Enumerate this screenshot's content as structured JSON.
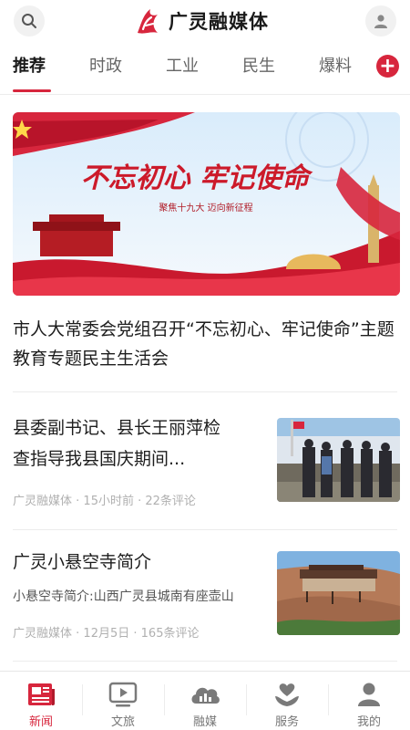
{
  "header": {
    "app_title": "广灵融媒体",
    "logo_icon": "logo-icon",
    "search_icon": "search-icon",
    "user_icon": "user-icon"
  },
  "tabs": [
    {
      "label": "推荐",
      "active": true
    },
    {
      "label": "时政"
    },
    {
      "label": "工业"
    },
    {
      "label": "民生"
    },
    {
      "label": "爆料"
    }
  ],
  "banner": {
    "slogan": "不忘初心 牢记使命",
    "subtitle": "聚焦十九大  迈向新征程"
  },
  "headline": {
    "title": "市人大常委会党组召开“不忘初心、牢记使命”主题教育专题民主生活会"
  },
  "news": [
    {
      "title_line1": "县委副书记、县长王丽萍检",
      "title_line2": "查指导我县国庆期间...",
      "source": "广灵融媒体",
      "time": "15小时前",
      "comments": "22条评论"
    },
    {
      "title_line1": "广灵小悬空寺简介",
      "summary": "小悬空寺简介:山西广灵县城南有座壶山",
      "source": "广灵融媒体",
      "time": "12月5日",
      "comments": "165条评论"
    }
  ],
  "bottom_nav": [
    {
      "label": "新闻",
      "icon": "newspaper-icon",
      "active": true
    },
    {
      "label": "文旅",
      "icon": "play-icon"
    },
    {
      "label": "融媒",
      "icon": "cloud-chart-icon"
    },
    {
      "label": "服务",
      "icon": "heart-hand-icon"
    },
    {
      "label": "我的",
      "icon": "user-icon"
    }
  ],
  "colors": {
    "accent": "#d7263d",
    "text": "#1d1d1d",
    "meta": "#b0b0b0"
  }
}
